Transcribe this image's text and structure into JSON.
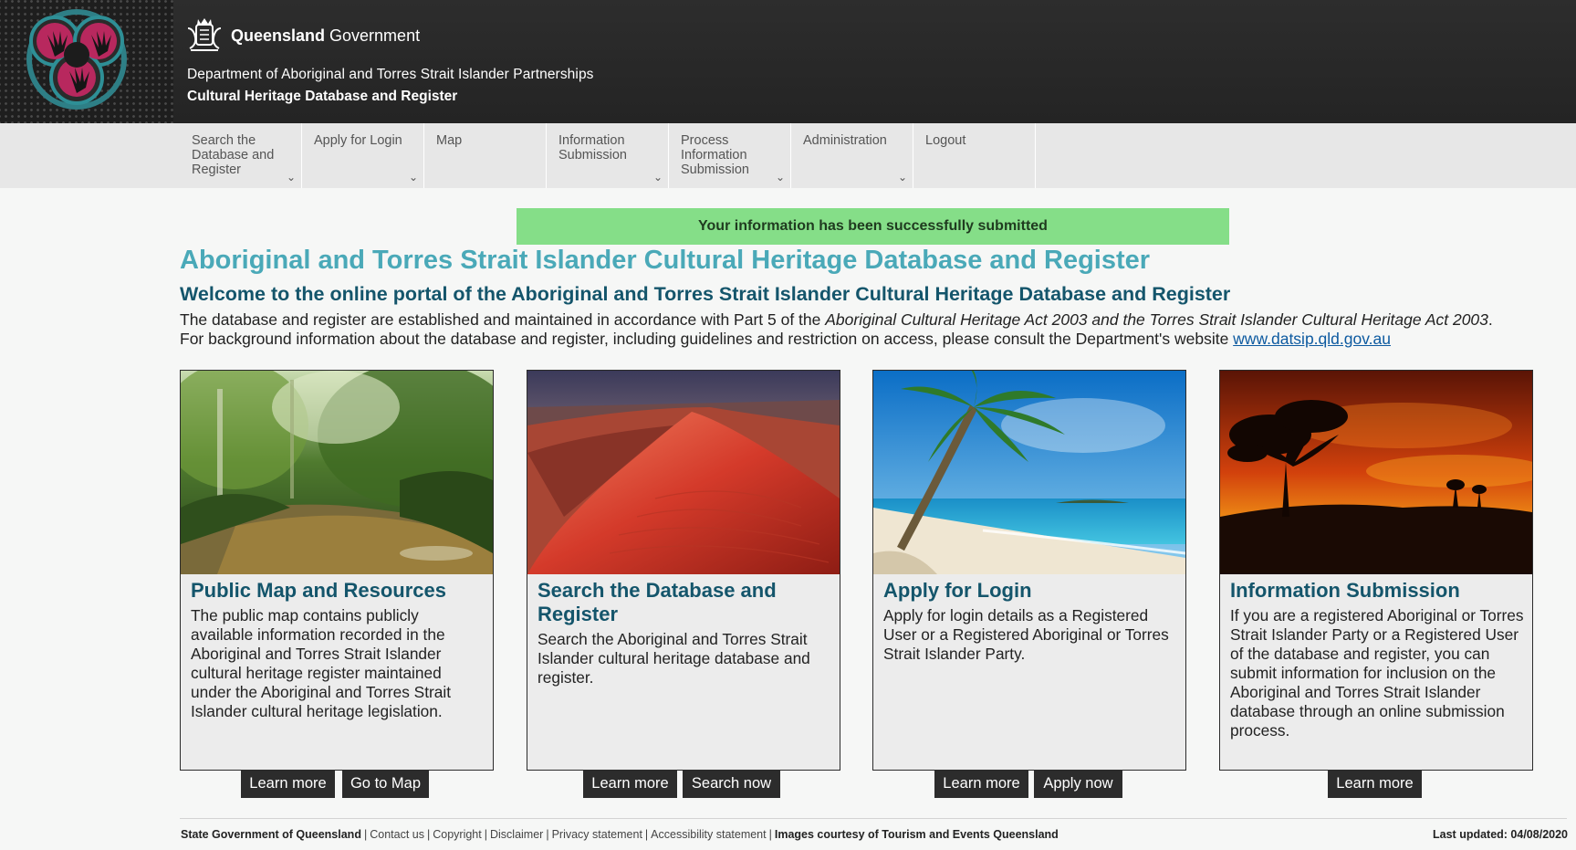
{
  "header": {
    "gov_bold": "Queensland",
    "gov_rest": " Government",
    "department": "Department of Aboriginal and Torres Strait Islander Partnerships",
    "subtitle": "Cultural Heritage Database and Register"
  },
  "nav": {
    "items": [
      {
        "label": "Search the Database and Register",
        "dropdown": true
      },
      {
        "label": "Apply for Login",
        "dropdown": true
      },
      {
        "label": "Map",
        "dropdown": false
      },
      {
        "label": "Information Submission",
        "dropdown": true
      },
      {
        "label": "Process Information Submission",
        "dropdown": true
      },
      {
        "label": "Administration",
        "dropdown": true
      },
      {
        "label": "Logout",
        "dropdown": false
      }
    ]
  },
  "alert": {
    "text": "Your information has been successfully submitted",
    "color": "#85de88"
  },
  "main": {
    "title": "Aboriginal and Torres Strait Islander Cultural Heritage Database and Register",
    "welcome": "Welcome to the online portal of the Aboriginal and Torres Strait Islander Cultural Heritage Database and Register",
    "intro_1_pre": "The database and register are established and maintained in accordance with Part 5 of the ",
    "intro_1_italic": "Aboriginal Cultural Heritage Act 2003 and the Torres Strait Islander Cultural Heritage Act 2003",
    "intro_1_post": ".",
    "intro_2_pre": "For background information about the database and register, including guidelines and restriction on access, please consult the Department's website ",
    "intro_2_link": "www.datsip.qld.gov.au"
  },
  "cards": [
    {
      "title": "Public Map and Resources",
      "text": "The public map contains publicly available information recorded in the Aboriginal and Torres Strait Islander cultural heritage register maintained under the Aboriginal and Torres Strait Islander cultural heritage legislation.",
      "buttons": [
        "Learn more",
        "Go to Map"
      ]
    },
    {
      "title": "Search the Database and Register",
      "text": "Search the Aboriginal and Torres Strait Islander cultural heritage database and register.",
      "buttons": [
        "Learn more",
        "Search now"
      ]
    },
    {
      "title": "Apply for Login",
      "text": "Apply for login details as a Registered User or a Registered Aboriginal or Torres Strait Islander Party.",
      "buttons": [
        "Learn more",
        "Apply now"
      ]
    },
    {
      "title": "Information Submission",
      "text": "If you are a registered Aboriginal or Torres Strait Islander Party or a Registered User of the database and register, you can submit information for inclusion on the Aboriginal and Torres Strait Islander database through an online submission process.",
      "buttons": [
        "Learn more"
      ]
    }
  ],
  "footer": {
    "state": "State Government of Queensland",
    "links": [
      "Contact us",
      "Copyright",
      "Disclaimer",
      "Privacy statement",
      "Accessibility statement"
    ],
    "credit": "Images courtesy of Tourism and Events Queensland",
    "updated": "Last updated: 04/08/2020"
  },
  "colors": {
    "title": "#4aa9b8",
    "heading": "#14556b",
    "button": "#2c2c2c",
    "header_bg": "#2a2a2a"
  }
}
